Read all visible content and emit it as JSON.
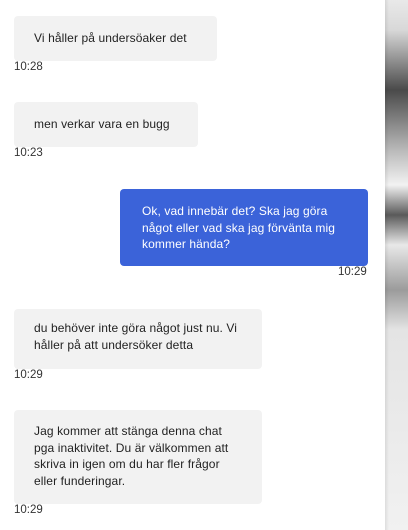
{
  "messages": [
    {
      "sender": "agent",
      "text": "Vi håller på undersöaker det",
      "time": "10:28"
    },
    {
      "sender": "agent",
      "text": "men verkar vara en bugg",
      "time": "10:23"
    },
    {
      "sender": "user",
      "text": "Ok, vad innebär det? Ska jag göra något eller vad ska jag förvänta mig kommer hända?",
      "time": "10:29"
    },
    {
      "sender": "agent",
      "text": "du behöver inte göra något just nu. Vi håller på att undersöker detta",
      "time": "10:29"
    },
    {
      "sender": "agent",
      "text": "Jag kommer att stänga denna chat pga inaktivitet. Du är välkommen att skriva in igen om du har fler frågor eller funderingar.",
      "time": "10:29"
    }
  ],
  "colors": {
    "agent_bubble": "#f2f2f2",
    "user_bubble": "#3b63d9",
    "user_text": "#ffffff",
    "agent_text": "#222222"
  }
}
